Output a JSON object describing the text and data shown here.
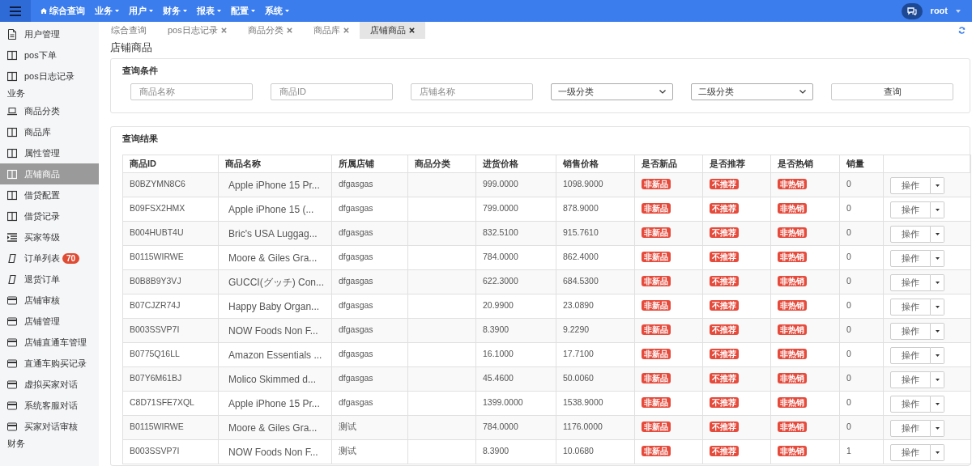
{
  "topbar": {
    "menu": [
      {
        "label": "综合查询",
        "kind": "home"
      },
      {
        "label": "业务",
        "kind": "dropdown"
      },
      {
        "label": "用户",
        "kind": "dropdown"
      },
      {
        "label": "财务",
        "kind": "dropdown"
      },
      {
        "label": "报表",
        "kind": "dropdown"
      },
      {
        "label": "配置",
        "kind": "dropdown"
      },
      {
        "label": "系统",
        "kind": "dropdown"
      }
    ],
    "user": "root"
  },
  "sidebar": {
    "items": [
      {
        "kind": "doc",
        "label": "用户管理",
        "selected": false
      },
      {
        "kind": "columns",
        "label": "pos下单",
        "selected": false
      },
      {
        "kind": "columns",
        "label": "pos日志记录",
        "selected": false
      },
      {
        "kind": "section",
        "label": "业务"
      },
      {
        "kind": "laptop",
        "label": "商品分类",
        "selected": false
      },
      {
        "kind": "columns",
        "label": "商品库",
        "selected": false
      },
      {
        "kind": "columns",
        "label": "属性管理",
        "selected": false
      },
      {
        "kind": "columns",
        "label": "店铺商品",
        "selected": true
      },
      {
        "kind": "columns",
        "label": "借贷配置",
        "selected": false
      },
      {
        "kind": "columns",
        "label": "借贷记录",
        "selected": false
      },
      {
        "kind": "list",
        "label": "买家等级",
        "selected": false
      },
      {
        "kind": "mobile",
        "label": "订单列表",
        "badge": "70",
        "selected": false
      },
      {
        "kind": "mobile",
        "label": "退货订单",
        "selected": false
      },
      {
        "kind": "card",
        "label": "店铺审核",
        "selected": false
      },
      {
        "kind": "card",
        "label": "店铺管理",
        "selected": false
      },
      {
        "kind": "card",
        "label": "店铺直通车管理",
        "selected": false
      },
      {
        "kind": "card",
        "label": "直通车购买记录",
        "selected": false
      },
      {
        "kind": "card",
        "label": "虚拟买家对话",
        "selected": false
      },
      {
        "kind": "card",
        "label": "系统客服对话",
        "selected": false
      },
      {
        "kind": "card",
        "label": "买家对话审核",
        "selected": false
      },
      {
        "kind": "section",
        "label": "财务"
      }
    ]
  },
  "tabs": [
    {
      "label": "综合查询",
      "closable": false,
      "selected": false
    },
    {
      "label": "pos日志记录",
      "closable": true,
      "selected": false
    },
    {
      "label": "商品分类",
      "closable": true,
      "selected": false
    },
    {
      "label": "商品库",
      "closable": true,
      "selected": false
    },
    {
      "label": "店铺商品",
      "closable": true,
      "selected": true
    }
  ],
  "page_title": "店铺商品",
  "query": {
    "title": "查询条件",
    "fields": [
      {
        "kind": "input",
        "placeholder": "商品名称"
      },
      {
        "kind": "input",
        "placeholder": "商品ID"
      },
      {
        "kind": "input",
        "placeholder": "店铺名称"
      },
      {
        "kind": "select",
        "value": "一级分类"
      },
      {
        "kind": "select",
        "value": "二级分类"
      }
    ],
    "button": "查询"
  },
  "results": {
    "title": "查询结果",
    "columns": [
      "商品ID",
      "商品名称",
      "所属店铺",
      "商品分类",
      "进货价格",
      "销售价格",
      "是否新品",
      "是否推荐",
      "是否热销",
      "销量"
    ],
    "rows": [
      [
        "B0BZYMN8C6",
        "Apple iPhone 15 Pr...",
        "dfgasgas",
        "",
        "999.0000",
        "1098.9000",
        "非新品",
        "不推荐",
        "非热销",
        "0",
        "操作"
      ],
      [
        "B09FSX2HMX",
        "Apple iPhone 15 (...",
        "dfgasgas",
        "",
        "799.0000",
        "878.9000",
        "非新品",
        "不推荐",
        "非热销",
        "0",
        "操作"
      ],
      [
        "B004HUBT4U",
        "Bric's USA Luggag...",
        "dfgasgas",
        "",
        "832.5100",
        "915.7610",
        "非新品",
        "不推荐",
        "非热销",
        "0",
        "操作"
      ],
      [
        "B0115WIRWE",
        "Moore & Giles Gra...",
        "dfgasgas",
        "",
        "784.0000",
        "862.4000",
        "非新品",
        "不推荐",
        "非热销",
        "0",
        "操作"
      ],
      [
        "B0B8B9Y3VJ",
        "GUCCI(グッチ) Con...",
        "dfgasgas",
        "",
        "622.3000",
        "684.5300",
        "非新品",
        "不推荐",
        "非热销",
        "0",
        "操作"
      ],
      [
        "B07CJZR74J",
        "Happy Baby Organ...",
        "dfgasgas",
        "",
        "20.9900",
        "23.0890",
        "非新品",
        "不推荐",
        "非热销",
        "0",
        "操作"
      ],
      [
        "B003SSVP7I",
        "NOW Foods Non F...",
        "dfgasgas",
        "",
        "8.3900",
        "9.2290",
        "非新品",
        "不推荐",
        "非热销",
        "0",
        "操作"
      ],
      [
        "B0775Q16LL",
        "Amazon Essentials ...",
        "dfgasgas",
        "",
        "16.1000",
        "17.7100",
        "非新品",
        "不推荐",
        "非热销",
        "0",
        "操作"
      ],
      [
        "B07Y6M61BJ",
        "Molico Skimmed d...",
        "dfgasgas",
        "",
        "45.4600",
        "50.0060",
        "非新品",
        "不推荐",
        "非热销",
        "0",
        "操作"
      ],
      [
        "C8D71SFE7XQL",
        "Apple iPhone 15 Pr...",
        "dfgasgas",
        "",
        "1399.0000",
        "1538.9000",
        "非新品",
        "不推荐",
        "非热销",
        "0",
        "操作"
      ],
      [
        "B0115WIRWE",
        "Moore & Giles Gra...",
        "测试",
        "",
        "784.0000",
        "1176.0000",
        "非新品",
        "不推荐",
        "非热销",
        "0",
        "操作"
      ],
      [
        "B003SSVP7I",
        "NOW Foods Non F...",
        "测试",
        "",
        "8.3900",
        "10.0680",
        "非新品",
        "不推荐",
        "非热销",
        "1",
        "操作"
      ]
    ]
  }
}
